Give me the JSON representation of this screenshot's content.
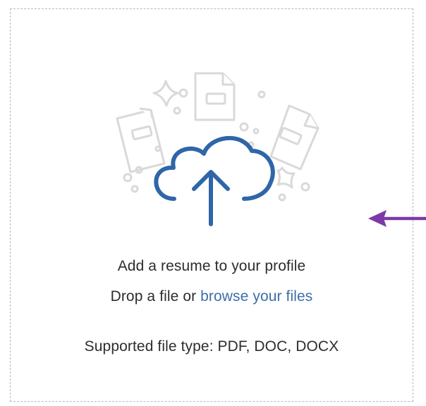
{
  "upload_zone": {
    "icons": {
      "main": "cloud-upload-icon",
      "documents": [
        "doc-file-icon",
        "pdf-file-icon",
        "docx-file-icon"
      ]
    },
    "title": "Add a resume to your profile",
    "drop_text": "Drop a file or ",
    "browse_link": "browse your files",
    "supported_types": "Supported file type: PDF, DOC, DOCX"
  },
  "annotation": {
    "icon": "pointer-arrow-icon",
    "color": "#7b3aa6"
  },
  "colors": {
    "accent": "#2f66a8",
    "link": "#3d6ea8",
    "text": "#2d2d2d",
    "border": "#b9b9b9",
    "decoration": "#d9d9d9"
  }
}
